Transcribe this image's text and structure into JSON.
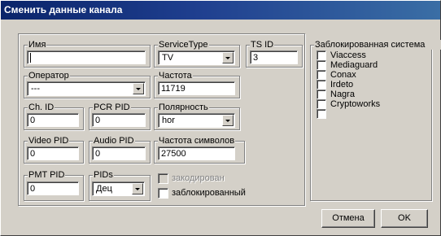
{
  "window": {
    "title": "Сменить данные канала"
  },
  "fields": {
    "name": {
      "label": "Имя",
      "value": ""
    },
    "service_type": {
      "label": "ServiceType",
      "value": "TV"
    },
    "ts_id": {
      "label": "TS ID",
      "value": "3"
    },
    "operator": {
      "label": "Оператор",
      "value": "---"
    },
    "frequency": {
      "label": "Частота",
      "value": "11719"
    },
    "ch_id": {
      "label": "Ch. ID",
      "value": "0"
    },
    "pcr_pid": {
      "label": "PCR PID",
      "value": "0"
    },
    "polarity": {
      "label": "Полярность",
      "value": "hor"
    },
    "video_pid": {
      "label": "Video PID",
      "value": "0"
    },
    "audio_pid": {
      "label": "Audio PID",
      "value": "0"
    },
    "symbol_rate": {
      "label": "Частота символов",
      "value": "27500"
    },
    "pmt_pid": {
      "label": "PMT PID",
      "value": "0"
    },
    "pids": {
      "label": "PIDs",
      "value": "Дец"
    }
  },
  "checkboxes": {
    "encoded": {
      "label": "закодирован",
      "checked": false,
      "disabled": true
    },
    "blocked": {
      "label": "заблокированный",
      "checked": false,
      "disabled": false
    }
  },
  "blocked_system": {
    "label": "Заблокированная система",
    "items": [
      {
        "label": "Viaccess",
        "checked": false
      },
      {
        "label": "Mediaguard",
        "checked": false
      },
      {
        "label": "Conax",
        "checked": false
      },
      {
        "label": "Irdeto",
        "checked": false
      },
      {
        "label": "Nagra",
        "checked": false
      },
      {
        "label": "Cryptoworks",
        "checked": false
      },
      {
        "label": "",
        "checked": false
      }
    ]
  },
  "buttons": {
    "cancel": "Отмена",
    "ok": "OK"
  },
  "colors": {
    "face": "#d4d0c8",
    "title_start": "#0a246a",
    "title_end": "#3a6ea5",
    "disabled_text": "#808080"
  }
}
